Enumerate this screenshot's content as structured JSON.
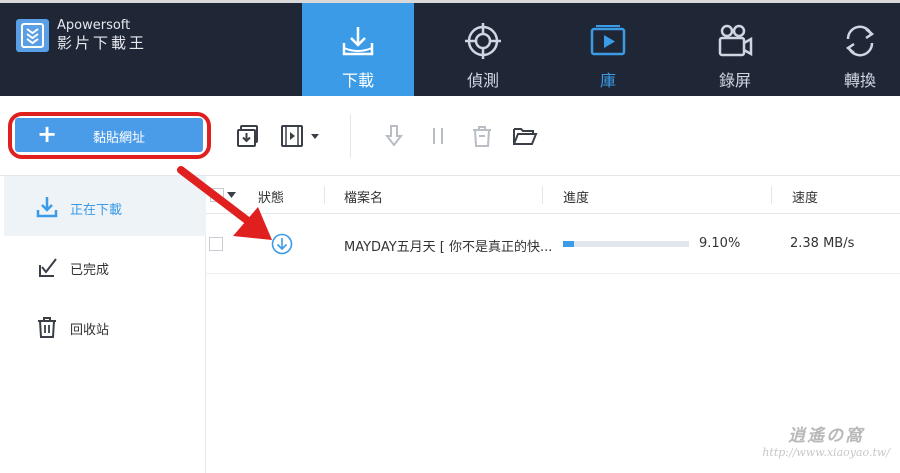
{
  "app": {
    "brand_line1": "Apowersoft",
    "brand_line2": "影片下載王"
  },
  "nav": [
    {
      "label": "下載",
      "icon": "download-tray-icon",
      "active": true
    },
    {
      "label": "偵測",
      "icon": "target-detect-icon",
      "active": false
    },
    {
      "label": "庫",
      "icon": "video-library-icon",
      "active": false
    },
    {
      "label": "錄屏",
      "icon": "camera-record-icon",
      "active": false
    },
    {
      "label": "轉換",
      "icon": "convert-sync-icon",
      "active": false
    }
  ],
  "toolbar": {
    "paste_plus": "+",
    "paste_label": "黏貼網址",
    "icons": [
      "import-download-icon",
      "video-menu-icon",
      "start-download-icon",
      "pause-icon",
      "delete-icon",
      "open-folder-icon"
    ]
  },
  "sidebar": {
    "items": [
      {
        "label": "正在下載",
        "icon": "download-icon",
        "active": true
      },
      {
        "label": "已完成",
        "icon": "check-box-icon",
        "active": false
      },
      {
        "label": "回收站",
        "icon": "trash-icon",
        "active": false
      }
    ]
  },
  "table": {
    "headers": {
      "status": "狀態",
      "filename": "檔案名",
      "progress": "進度",
      "speed": "速度"
    },
    "rows": [
      {
        "filename": "MAYDAY五月天 [ 你不是真正的快...",
        "progress_percent": 9.1,
        "progress_text": "9.10%",
        "speed": "2.38 MB/s",
        "status_icon": "downloading-icon"
      }
    ]
  },
  "colors": {
    "accent": "#3b9be6",
    "topbar": "#1f2737",
    "annotation_red": "#e01f1f"
  }
}
